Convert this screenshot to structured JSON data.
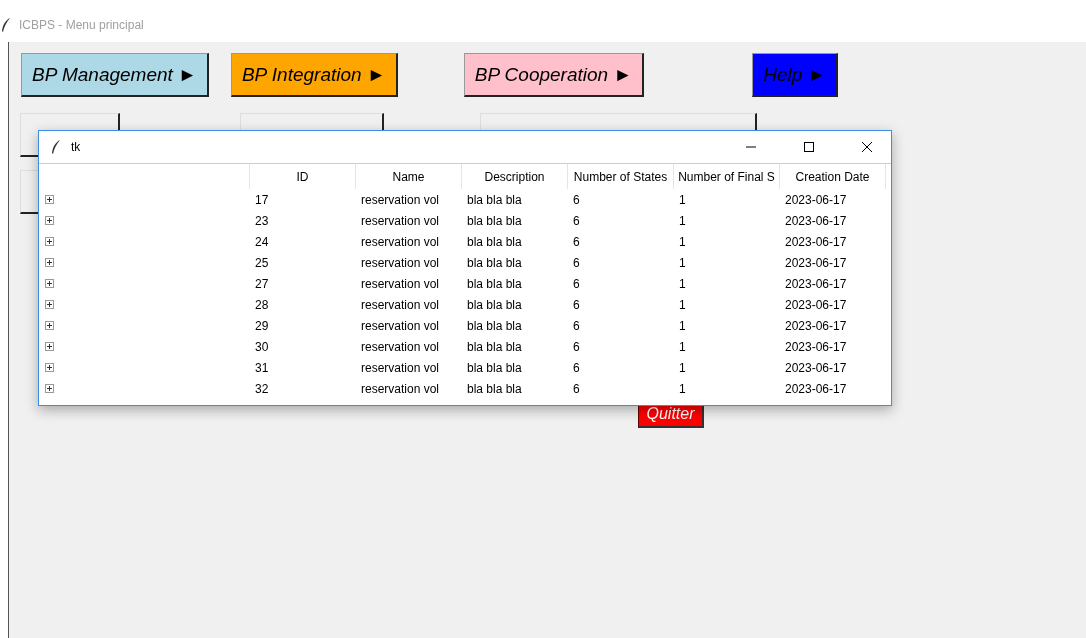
{
  "window": {
    "title": "ICBPS - Menu principal"
  },
  "menu_buttons": [
    {
      "label": "BP Management ►",
      "color": "#add8e6"
    },
    {
      "label": "BP Integration ►",
      "color": "#ffa500"
    },
    {
      "label": "BP Cooperation ►",
      "color": "#ffc0cb"
    },
    {
      "label": "Help ►",
      "color": "#0000ff"
    }
  ],
  "quit_button": {
    "label": "Quitter"
  },
  "dialog": {
    "title": "tk",
    "columns": [
      "ID",
      "Name",
      "Description",
      "Number of States",
      "Number of Final S",
      "Creation Date"
    ],
    "rows": [
      {
        "expanded": false,
        "cells": [
          "17",
          "reservation vol",
          "bla bla bla",
          "6",
          "1",
          "2023-06-17"
        ]
      },
      {
        "expanded": false,
        "cells": [
          "23",
          "reservation vol",
          "bla bla bla",
          "6",
          "1",
          "2023-06-17"
        ]
      },
      {
        "expanded": false,
        "cells": [
          "24",
          "reservation vol",
          "bla bla bla",
          "6",
          "1",
          "2023-06-17"
        ]
      },
      {
        "expanded": false,
        "cells": [
          "25",
          "reservation vol",
          "bla bla bla",
          "6",
          "1",
          "2023-06-17"
        ]
      },
      {
        "expanded": false,
        "cells": [
          "27",
          "reservation vol",
          "bla bla bla",
          "6",
          "1",
          "2023-06-17"
        ]
      },
      {
        "expanded": false,
        "cells": [
          "28",
          "reservation vol",
          "bla bla bla",
          "6",
          "1",
          "2023-06-17"
        ]
      },
      {
        "expanded": false,
        "cells": [
          "29",
          "reservation vol",
          "bla bla bla",
          "6",
          "1",
          "2023-06-17"
        ]
      },
      {
        "expanded": false,
        "cells": [
          "30",
          "reservation vol",
          "bla bla bla",
          "6",
          "1",
          "2023-06-17"
        ]
      },
      {
        "expanded": false,
        "cells": [
          "31",
          "reservation vol",
          "bla bla bla",
          "6",
          "1",
          "2023-06-17"
        ]
      },
      {
        "expanded": false,
        "cells": [
          "32",
          "reservation vol",
          "bla bla bla",
          "6",
          "1",
          "2023-06-17"
        ]
      }
    ]
  }
}
